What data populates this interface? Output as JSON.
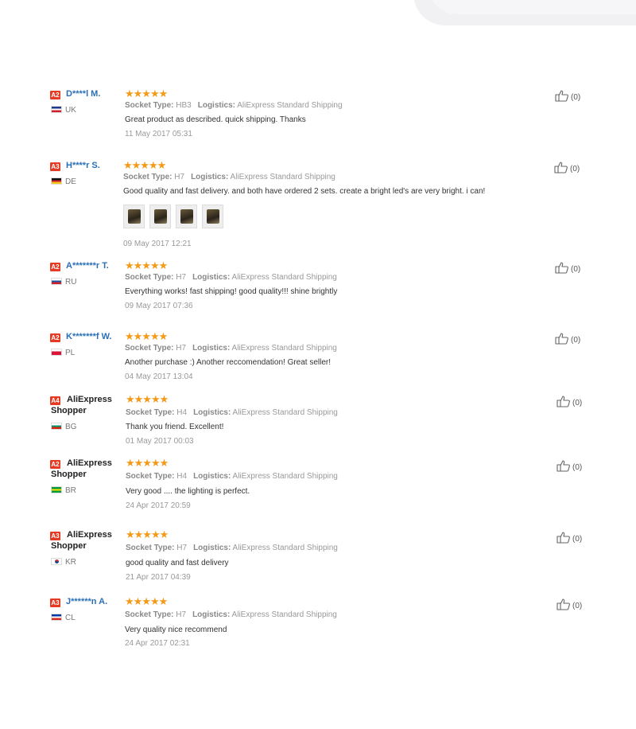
{
  "labels": {
    "socket": "Socket Type:",
    "logistics": "Logistics:"
  },
  "reviews": [
    {
      "badge": "A2",
      "name": "D****l M.",
      "country": "UK",
      "flag_colors": [
        "#1f3a8a",
        "#ffffff",
        "#d0202e"
      ],
      "stars": "★★★★★",
      "socket": "HB3",
      "logistics": "AliExpress Standard Shipping",
      "text": "Great product as described. quick shipping. Thanks",
      "date": "11 May 2017 05:31",
      "helpful": "(0)"
    },
    {
      "badge": "A3",
      "name": "H****r S.",
      "country": "DE",
      "flag_colors": [
        "#111111",
        "#d0202e",
        "#f5c518"
      ],
      "stars": "★★★★★",
      "socket": "H7",
      "logistics": "AliExpress Standard Shipping",
      "text": "Good quality and fast delivery. and both have ordered 2 sets. create a bright led's are very bright. i can!",
      "date": "09 May 2017 12:21",
      "helpful": "(0)",
      "photos": 4
    },
    {
      "badge": "A2",
      "name": "A*******r T.",
      "country": "RU",
      "flag_colors": [
        "#ffffff",
        "#1c57a5",
        "#d0202e"
      ],
      "stars": "★★★★★",
      "socket": "H7",
      "logistics": "AliExpress Standard Shipping",
      "text": "Everything works! fast shipping! good quality!!! shine brightly",
      "date": "09 May 2017 07:36",
      "helpful": "(0)"
    },
    {
      "badge": "A2",
      "name": "K*******f W.",
      "country": "PL",
      "flag_colors": [
        "#ffffff",
        "#dc143c",
        "#dc143c"
      ],
      "stars": "★★★★★",
      "socket": "H7",
      "logistics": "AliExpress Standard Shipping",
      "text": "Another purchase :) Another reccomendation! Great seller!",
      "date": "04 May 2017 13:04",
      "helpful": "(0)"
    },
    {
      "badge": "A4",
      "name": "AliExpress Shopper",
      "country": "BG",
      "flag_colors": [
        "#ffffff",
        "#00966e",
        "#d62612"
      ],
      "stars": "★★★★★",
      "socket": "H4",
      "logistics": "AliExpress Standard Shipping",
      "text": "Thank you friend. Excellent!",
      "date": "01 May 2017 00:03",
      "helpful": "(0)"
    },
    {
      "badge": "A2",
      "name": "AliExpress Shopper",
      "country": "BR",
      "flag_colors": [
        "#009c3b",
        "#ffdf00",
        "#009c3b"
      ],
      "stars": "★★★★★",
      "socket": "H4",
      "logistics": "AliExpress Standard Shipping",
      "text": "Very good .... the lighting is perfect.",
      "date": "24 Apr 2017 20:59",
      "helpful": "(0)"
    },
    {
      "badge": "A3",
      "name": "AliExpress Shopper",
      "country": "KR",
      "flag_colors": [
        "#ffffff",
        "#ffffff",
        "#ffffff"
      ],
      "stars": "★★★★★",
      "socket": "H7",
      "logistics": "AliExpress Standard Shipping",
      "text": "good quality and fast delivery",
      "date": "21 Apr 2017 04:39",
      "helpful": "(0)"
    },
    {
      "badge": "A3",
      "name": "J******n A.",
      "country": "CL",
      "flag_colors": [
        "#0039a6",
        "#ffffff",
        "#d52b1e"
      ],
      "stars": "★★★★★",
      "socket": "H7",
      "logistics": "AliExpress Standard Shipping",
      "text": "Very quality nice recommend",
      "date": "24 Apr 2017 02:31",
      "helpful": "(0)"
    }
  ]
}
